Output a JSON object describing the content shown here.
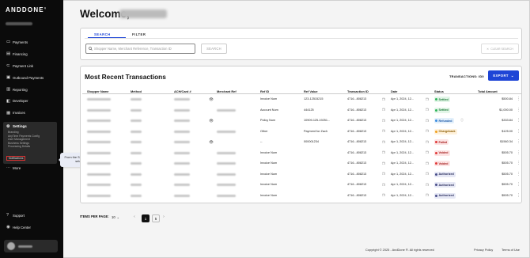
{
  "brand": {
    "logo_text": "ANDDONE"
  },
  "sidebar": {
    "nav": [
      {
        "label": "Payments",
        "icon": "credit-card-icon"
      },
      {
        "label": "Financing",
        "icon": "document-icon"
      },
      {
        "label": "Payment Link",
        "icon": "link-icon"
      },
      {
        "label": "Outbound Payments",
        "icon": "outbound-icon"
      },
      {
        "label": "Reporting",
        "icon": "report-icon"
      },
      {
        "label": "Developer",
        "icon": "code-icon"
      },
      {
        "label": "Invoices",
        "icon": "invoice-icon"
      }
    ],
    "settings": {
      "label": "Settings",
      "items": [
        "Branding",
        "AnyTime Payments Config",
        "User Management",
        "Business Settings",
        "Processing Details",
        "Notifications"
      ]
    },
    "more_label": "More",
    "bottom": [
      {
        "label": "Support",
        "icon": "question-icon"
      },
      {
        "label": "Help Center",
        "icon": "help-icon"
      }
    ]
  },
  "tooltip": {
    "text": "From the Settings drop-down menu select Notifications."
  },
  "header": {
    "welcome": "Welcome,"
  },
  "search": {
    "tab_search": "SEARCH",
    "tab_filter": "FILTER",
    "placeholder": "Shopper Name, Merchant Reference, Transaction ID",
    "search_button": "SEARCH",
    "clear_button": "CLEAR SEARCH"
  },
  "transactions": {
    "title": "Most Recent Transactions",
    "id_label": "TRANSACTIONS: ID0",
    "export_label": "EXPORT",
    "columns": [
      "Shopper Name",
      "Method",
      "ACH/Card #",
      "Merchant Ref",
      "Ref ID",
      "Ref Value",
      "Transaction ID",
      "Date",
      "Status",
      "Total Amount"
    ],
    "rows": [
      {
        "ref_id": "Invoice Num",
        "ref_value": "123-12515215",
        "txn_id": "4716...808213",
        "date": "Apr 1, 2024, 12...",
        "status": "Settled",
        "amount": "$500.84",
        "eye": true
      },
      {
        "ref_id": "Account Num",
        "ref_value": "444125",
        "txn_id": "4716...808213",
        "date": "Apr 1, 2024, 12...",
        "status": "Settled",
        "amount": "$1,000.00",
        "eye": false
      },
      {
        "ref_id": "Policy Num",
        "ref_value": "10909-125-19251...",
        "txn_id": "4716...808213",
        "date": "Apr 1, 2024, 12...",
        "status": "Refunded",
        "amount": "$333.84",
        "eye": true
      },
      {
        "ref_id": "Other",
        "ref_value": "Payment for Zach",
        "txn_id": "4716...808213",
        "date": "Apr 1, 2024, 12...",
        "status": "Chargeback",
        "amount": "$125.00",
        "eye": false
      },
      {
        "ref_id": "--",
        "ref_value": "000001234",
        "txn_id": "4716...808213",
        "date": "Apr 1, 2024, 12...",
        "status": "Failed",
        "amount": "$1560.34",
        "eye": true
      },
      {
        "ref_id": "Invoice Num",
        "ref_value": "",
        "txn_id": "4716...808213",
        "date": "Apr 1, 2024, 12...",
        "status": "Voided",
        "amount": "$505.70",
        "eye": false
      },
      {
        "ref_id": "Invoice Num",
        "ref_value": "",
        "txn_id": "4716...808213",
        "date": "Apr 1, 2024, 12...",
        "status": "Voided",
        "amount": "$505.70",
        "eye": false
      },
      {
        "ref_id": "Invoice Num",
        "ref_value": "",
        "txn_id": "4716...808213",
        "date": "Apr 1, 2024, 12...",
        "status": "Authorized",
        "amount": "$505.70",
        "eye": false
      },
      {
        "ref_id": "Invoice Num",
        "ref_value": "",
        "txn_id": "4716...808213",
        "date": "Apr 1, 2024, 12...",
        "status": "Authorized",
        "amount": "$505.70",
        "eye": false
      },
      {
        "ref_id": "Invoice Num",
        "ref_value": "",
        "txn_id": "4716...808213",
        "date": "Apr 1, 2024, 12...",
        "status": "Authorized",
        "amount": "$505.70",
        "eye": false
      }
    ]
  },
  "status_colors": {
    "Settled": {
      "bg": "#e3f6e8",
      "fg": "#1f7a3a",
      "dot": "#2fb45a"
    },
    "Refunded": {
      "bg": "#e3f0fb",
      "fg": "#1e5aa8",
      "dot": "#3b8de0"
    },
    "Chargeback": {
      "bg": "#fff2dc",
      "fg": "#8a5a00",
      "dot": "#f0a020"
    },
    "Failed": {
      "bg": "#fde4e4",
      "fg": "#a31b1b",
      "dot": "#e03a3a"
    },
    "Voided": {
      "bg": "#fde4e4",
      "fg": "#a31b1b",
      "dot": "#e03a3a"
    },
    "Authorized": {
      "bg": "#e6e8f5",
      "fg": "#2b2f5e",
      "dot": "#4a4f8a"
    }
  },
  "pagination": {
    "items_label": "ITEMS PER PAGE:",
    "per_page": "10",
    "pages": [
      "1",
      "5"
    ]
  },
  "footer": {
    "copyright": "Copyright © 2025 - AndDone ®. All rights reserved",
    "privacy": "Privacy Policy",
    "terms": "Terms of Use"
  },
  "accent": "#1e45d6"
}
